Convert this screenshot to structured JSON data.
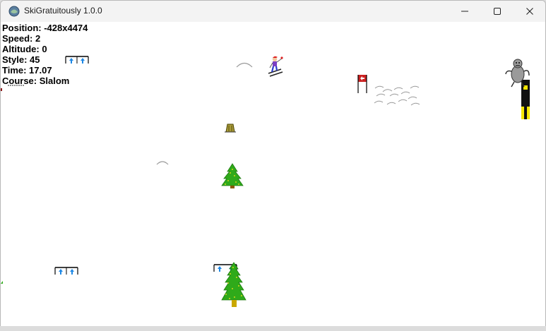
{
  "window": {
    "title": "SkiGratuitously 1.0.0",
    "controls": [
      "minimize-icon",
      "maximize-icon",
      "close-icon"
    ]
  },
  "hud": {
    "position": "Position: -428x4474",
    "speed": "Speed: 2",
    "altitude": "Altitude: 0",
    "style": "Style: 45",
    "time": "Time: 17.07",
    "course": "Course: Slalom"
  },
  "game": {
    "background_color": "#ffffff",
    "tree_color": "#2faa1a",
    "flag_color": "#cc2222",
    "gate_color": "#1e88e5",
    "sprites": [
      "skier",
      "yeti",
      "slalom-flag",
      "trees",
      "tree-stump",
      "snow-mogul",
      "rocky-mogul-field",
      "slalom-gates"
    ]
  }
}
